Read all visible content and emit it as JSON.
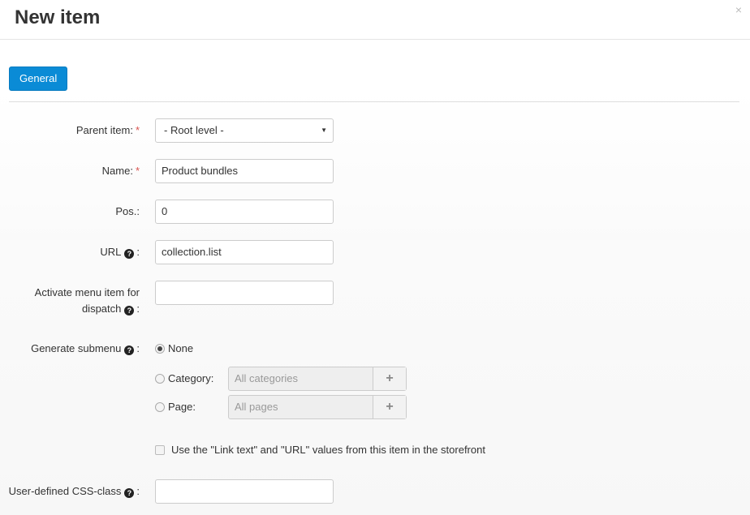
{
  "dialog": {
    "title": "New item",
    "close_symbol": "×"
  },
  "tabs": [
    {
      "label": "General",
      "active": true
    }
  ],
  "form": {
    "parent_item": {
      "label": "Parent item:",
      "required_mark": "*",
      "value": "- Root level -",
      "arrow": "▼"
    },
    "name": {
      "label": "Name:",
      "required_mark": "*",
      "value": "Product bundles"
    },
    "pos": {
      "label": "Pos.:",
      "value": "0"
    },
    "url": {
      "label": "URL",
      "help_icon": "?",
      "colon": ":",
      "value": "collection.list"
    },
    "activate_dispatch": {
      "label_line1": "Activate menu item for",
      "label_line2": "dispatch",
      "help_icon": "?",
      "colon": ":",
      "value": ""
    },
    "generate_submenu": {
      "label": "Generate submenu",
      "help_icon": "?",
      "colon": ":",
      "options": [
        {
          "label": "None",
          "checked": true
        },
        {
          "label": "Category:",
          "checked": false,
          "picker_placeholder": "All categories",
          "add_symbol": "+"
        },
        {
          "label": "Page:",
          "checked": false,
          "picker_placeholder": "All pages",
          "add_symbol": "+"
        }
      ]
    },
    "use_link_text": {
      "label": "Use the \"Link text\" and \"URL\" values from this item in the storefront",
      "checked": false
    },
    "css_class": {
      "label": "User-defined CSS-class",
      "help_icon": "?",
      "colon": ":",
      "value": ""
    }
  },
  "colors": {
    "accent": "#0a8bd6",
    "required": "#d9534f"
  },
  "icons": {
    "help": "question-circle-icon",
    "close": "close-icon",
    "add": "plus-icon",
    "dropdown": "caret-down-icon"
  }
}
